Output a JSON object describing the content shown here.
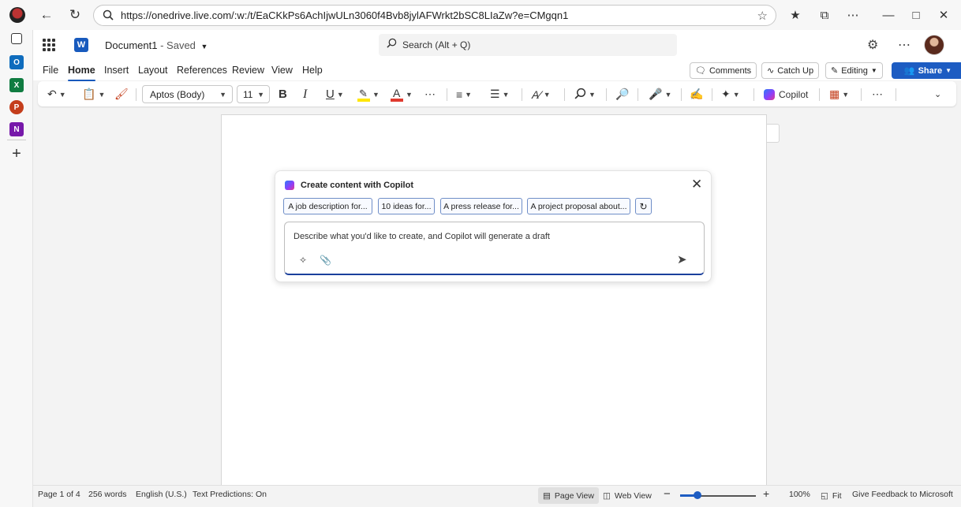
{
  "browser": {
    "url": "https://onedrive.live.com/:w:/t/EaCKkPs6AchIjwULn3060f4Bvb8jylAFWrkt2bSC8LIaZw?e=CMgqn1"
  },
  "header": {
    "doc_name": "Document1",
    "doc_status": " - Saved",
    "search_placeholder": "Search (Alt + Q)"
  },
  "menu": {
    "tabs": [
      "File",
      "Home",
      "Insert",
      "Layout",
      "References",
      "Review",
      "View",
      "Help"
    ],
    "active_tab": "Home",
    "comments_label": "Comments",
    "catchup_label": "Catch Up",
    "editing_label": "Editing",
    "share_label": "Share"
  },
  "ribbon": {
    "font_name": "Aptos (Body)",
    "font_size": "11",
    "bold": "B",
    "italic": "I",
    "underline": "U",
    "copilot_label": "Copilot",
    "highlight_color": "#ffe600",
    "font_color": "#e03a2f"
  },
  "copilot": {
    "title": "Create content with Copilot",
    "suggestions": [
      "A job description for...",
      "10 ideas for...",
      "A press release for...",
      "A project proposal about..."
    ],
    "prompt_placeholder": "Describe what you'd like to create, and Copilot will generate a draft"
  },
  "status": {
    "page": "Page 1 of 4",
    "words": "256 words",
    "language": "English (U.S.)",
    "text_predictions": "Text Predictions: On",
    "page_view": "Page View",
    "web_view": "Web View",
    "zoom": "100%",
    "fit": "Fit",
    "feedback": "Give Feedback to Microsoft"
  },
  "colors": {
    "accent": "#185abd",
    "share_bg": "#1d5cc2"
  }
}
